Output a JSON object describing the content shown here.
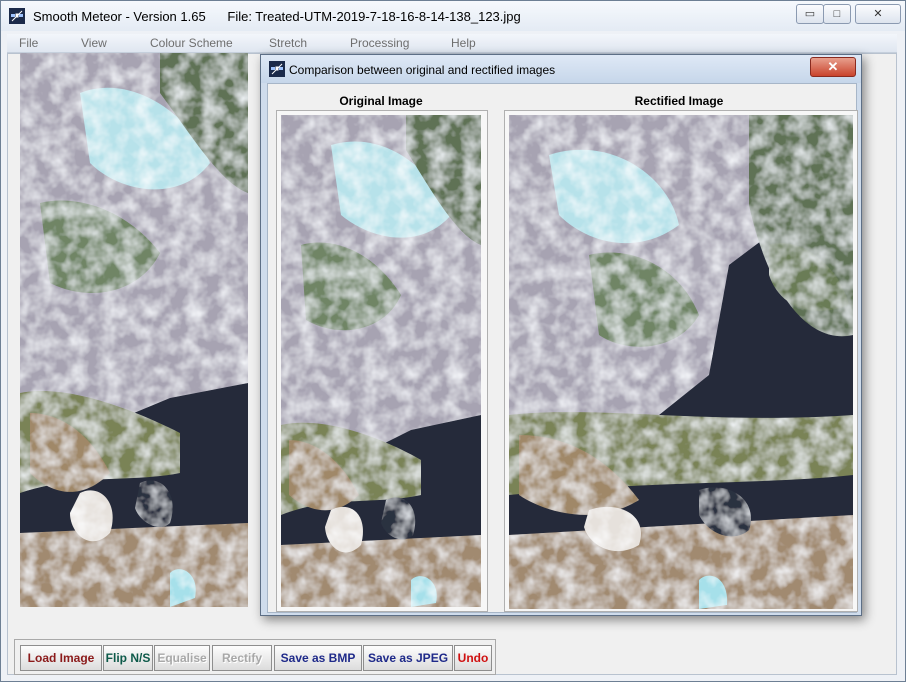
{
  "window": {
    "title": "Smooth Meteor - Version 1.65      File: Treated-UTM-2019-7-18-16-8-14-138_123.jpg",
    "controls": {
      "minimize": "▭",
      "maximize": "□",
      "close": "✕"
    }
  },
  "menu": {
    "items": [
      "File",
      "View",
      "Colour Scheme",
      "Stretch",
      "Processing",
      "Help"
    ]
  },
  "toolbar": {
    "buttons": [
      {
        "label": "Load Image",
        "color": "#8b1a1a",
        "enabled": true
      },
      {
        "label": "Flip N/S",
        "color": "#0e5a4a",
        "enabled": true
      },
      {
        "label": "Equalise",
        "color": "#a8a8a8",
        "enabled": false
      },
      {
        "label": "Rectify",
        "color": "#a8a8a8",
        "enabled": false
      },
      {
        "label": "Save as BMP",
        "color": "#1f2a8a",
        "enabled": true
      },
      {
        "label": "Save as JPEG",
        "color": "#1f2a8a",
        "enabled": true
      },
      {
        "label": "Undo",
        "color": "#d01010",
        "enabled": true
      }
    ]
  },
  "dialog": {
    "title": "Comparison between original and rectified images",
    "close_label": "✕",
    "original_label": "Original Image",
    "rectified_label": "Rectified Image"
  },
  "colors": {
    "cloud": "#dcdfe6",
    "cloud_cyan": "#a9e2ee",
    "sea": "#1d2232",
    "land_green": "#6d7c55",
    "land_brown": "#9a8060"
  }
}
